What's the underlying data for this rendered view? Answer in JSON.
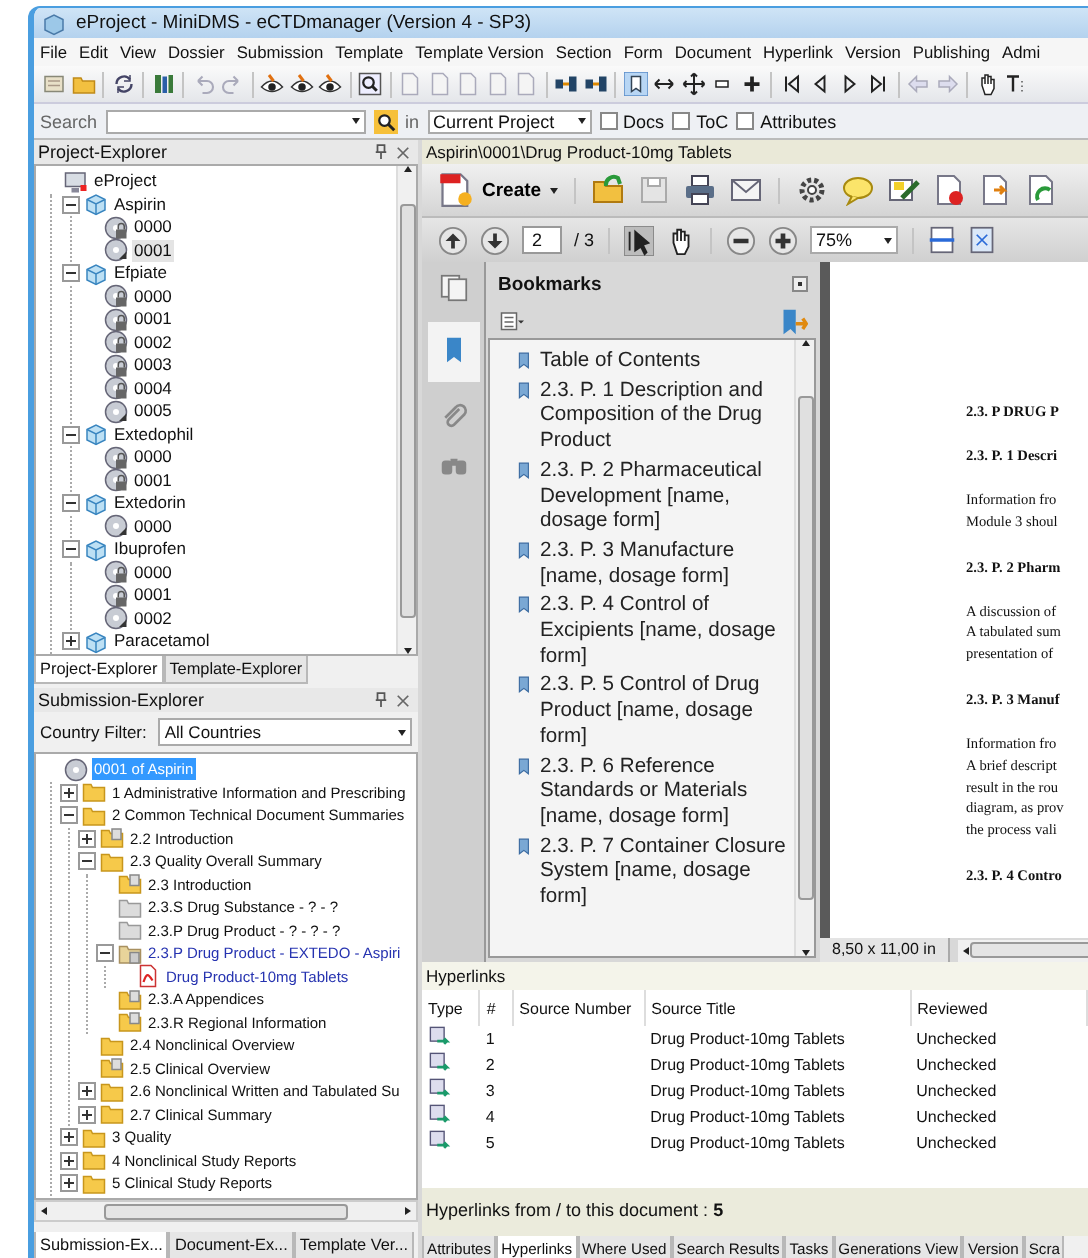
{
  "window": {
    "title": "eProject - MiniDMS - eCTDmanager (Version 4 - SP3)"
  },
  "menu": [
    "File",
    "Edit",
    "View",
    "Dossier",
    "Submission",
    "Template",
    "Template Version",
    "Section",
    "Form",
    "Document",
    "Hyperlink",
    "Version",
    "Publishing",
    "Admi"
  ],
  "search_bar": {
    "label": "Search",
    "scope_label": "in",
    "scope": "Current Project",
    "options": [
      {
        "label": "Docs",
        "checked": false
      },
      {
        "label": "ToC",
        "checked": false
      },
      {
        "label": "Attributes",
        "checked": false
      }
    ]
  },
  "project_explorer": {
    "title": "Project-Explorer",
    "tree": [
      {
        "label": "eProject",
        "kind": "project",
        "selected": false,
        "children": [
          {
            "label": "Aspirin",
            "kind": "product",
            "expanded": true,
            "selected": false,
            "children": [
              {
                "label": "0000",
                "kind": "sequence",
                "locked": true,
                "selected": false
              },
              {
                "label": "0001",
                "kind": "sequence",
                "locked": false,
                "selected": true
              }
            ]
          },
          {
            "label": "Efpiate",
            "kind": "product",
            "expanded": true,
            "selected": false,
            "children": [
              {
                "label": "0000",
                "kind": "sequence",
                "locked": true,
                "selected": false
              },
              {
                "label": "0001",
                "kind": "sequence",
                "locked": true,
                "selected": false
              },
              {
                "label": "0002",
                "kind": "sequence",
                "locked": true,
                "selected": false
              },
              {
                "label": "0003",
                "kind": "sequence",
                "locked": true,
                "selected": false
              },
              {
                "label": "0004",
                "kind": "sequence",
                "locked": true,
                "selected": false
              },
              {
                "label": "0005",
                "kind": "sequence",
                "locked": false,
                "selected": false
              }
            ]
          },
          {
            "label": "Extedophil",
            "kind": "product",
            "expanded": true,
            "selected": false,
            "children": [
              {
                "label": "0000",
                "kind": "sequence",
                "locked": true,
                "selected": false
              },
              {
                "label": "0001",
                "kind": "sequence",
                "locked": true,
                "selected": false
              }
            ]
          },
          {
            "label": "Extedorin",
            "kind": "product",
            "expanded": true,
            "selected": false,
            "children": [
              {
                "label": "0000",
                "kind": "sequence",
                "locked": false,
                "selected": false
              }
            ]
          },
          {
            "label": "Ibuprofen",
            "kind": "product",
            "expanded": true,
            "selected": false,
            "children": [
              {
                "label": "0000",
                "kind": "sequence",
                "locked": true,
                "selected": false
              },
              {
                "label": "0001",
                "kind": "sequence",
                "locked": true,
                "selected": false
              },
              {
                "label": "0002",
                "kind": "sequence",
                "locked": false,
                "selected": false
              }
            ]
          },
          {
            "label": "Paracetamol",
            "kind": "product",
            "expanded": false,
            "selected": false
          }
        ]
      }
    ]
  },
  "explorer_tabs": [
    {
      "label": "Project-Explorer",
      "selected": true
    },
    {
      "label": "Template-Explorer",
      "selected": false
    }
  ],
  "submission_explorer": {
    "title": "Submission-Explorer",
    "filter_label": "Country Filter:",
    "filter_value": "All Countries",
    "tree": [
      {
        "label": "0001 of Aspirin",
        "kind": "submission",
        "selected": true,
        "children": [
          {
            "label": "1 Administrative Information and Prescribing",
            "kind": "folder",
            "expanded": false,
            "selected": false
          },
          {
            "label": "2 Common Technical Document Summaries",
            "kind": "folder",
            "expanded": true,
            "selected": false,
            "children": [
              {
                "label": "2.2 Introduction",
                "kind": "folder-with-page",
                "expanded": false,
                "selected": false
              },
              {
                "label": "2.3 Quality Overall Summary",
                "kind": "folder",
                "expanded": true,
                "selected": false,
                "children": [
                  {
                    "label": "2.3 Introduction",
                    "kind": "folder-with-page",
                    "selected": false
                  },
                  {
                    "label": "2.3.S Drug Substance - ? - ?",
                    "kind": "empty-folder",
                    "selected": false
                  },
                  {
                    "label": "2.3.P Drug Product - ? - ? - ?",
                    "kind": "empty-folder",
                    "selected": false
                  },
                  {
                    "label": "2.3.P Drug Product - EXTEDO - Aspiri",
                    "kind": "linked-folder",
                    "expanded": true,
                    "selected": false,
                    "children": [
                      {
                        "label": "Drug Product-10mg Tablets",
                        "kind": "document",
                        "selected": false
                      }
                    ]
                  },
                  {
                    "label": "2.3.A Appendices",
                    "kind": "folder-with-page",
                    "selected": false
                  },
                  {
                    "label": "2.3.R Regional Information",
                    "kind": "folder-with-page",
                    "selected": false
                  }
                ]
              },
              {
                "label": "2.4 Nonclinical Overview",
                "kind": "folder",
                "selected": false
              },
              {
                "label": "2.5 Clinical Overview",
                "kind": "folder-with-page",
                "selected": false
              },
              {
                "label": "2.6 Nonclinical Written and Tabulated Su",
                "kind": "folder",
                "expanded": false,
                "selected": false
              },
              {
                "label": "2.7 Clinical Summary",
                "kind": "folder",
                "expanded": false,
                "selected": false
              }
            ]
          },
          {
            "label": "3 Quality",
            "kind": "folder",
            "expanded": false,
            "selected": false
          },
          {
            "label": "4 Nonclinical Study Reports",
            "kind": "folder",
            "expanded": false,
            "selected": false
          },
          {
            "label": "5 Clinical Study Reports",
            "kind": "folder",
            "expanded": false,
            "selected": false
          }
        ]
      }
    ]
  },
  "left_tabs": [
    {
      "label": "Submission-Ex...",
      "selected": true
    },
    {
      "label": "Document-Ex...",
      "selected": false
    },
    {
      "label": "Template Ver...",
      "selected": false
    }
  ],
  "document": {
    "path": "Aspirin\\0001\\Drug Product-10mg Tablets",
    "create": "Create",
    "page": "2",
    "page_count": "/ 3",
    "zoom": "75%",
    "page_size": "8,50 x 11,00 in"
  },
  "bookmarks": {
    "title": "Bookmarks",
    "items": [
      "Table of Contents",
      "2.3. P. 1 Description and Composition of the Drug Product",
      "2.3. P. 2 Pharmaceutical Development [name, dosage form]",
      "2.3. P. 3 Manufacture [name, dosage form]",
      "2.3. P. 4 Control of Excipients [name, dosage form]",
      "2.3. P. 5 Control of Drug Product [name, dosage form]",
      "2.3. P. 6 Reference Standards or Materials [name, dosage form]",
      "2.3. P. 7 Container Closure System [name, dosage form]"
    ]
  },
  "page_content": [
    {
      "kind": "heading",
      "text": "2.3. P DRUG P"
    },
    {
      "kind": "heading",
      "text": "2.3. P. 1 Descri"
    },
    {
      "kind": "paragraph",
      "lines": [
        "Information fro",
        "Module 3 shoul"
      ]
    },
    {
      "kind": "heading",
      "text": "2.3. P. 2 Pharm"
    },
    {
      "kind": "paragraph",
      "lines": [
        "A discussion of",
        "A tabulated sum",
        "presentation of"
      ]
    },
    {
      "kind": "heading",
      "text": "2.3. P. 3 Manuf"
    },
    {
      "kind": "paragraph",
      "lines": [
        "Information fro",
        "A brief descript",
        "result in the rou",
        "diagram, as prov",
        "the process vali"
      ]
    },
    {
      "kind": "heading",
      "text": "2.3. P. 4 Contro"
    }
  ],
  "hyperlinks": {
    "title": "Hyperlinks",
    "columns": [
      "Type",
      "#",
      "Source Number",
      "Source Title",
      "Reviewed"
    ],
    "rows": [
      {
        "number": "1",
        "source_title": "Drug Product-10mg Tablets",
        "reviewed": "Unchecked"
      },
      {
        "number": "2",
        "source_title": "Drug Product-10mg Tablets",
        "reviewed": "Unchecked"
      },
      {
        "number": "3",
        "source_title": "Drug Product-10mg Tablets",
        "reviewed": "Unchecked"
      },
      {
        "number": "4",
        "source_title": "Drug Product-10mg Tablets",
        "reviewed": "Unchecked"
      },
      {
        "number": "5",
        "source_title": "Drug Product-10mg Tablets",
        "reviewed": "Unchecked"
      }
    ],
    "summary": "Hyperlinks from / to this document : **5**"
  },
  "bottom_tabs": [
    {
      "label": "Attributes",
      "selected": false
    },
    {
      "label": "Hyperlinks",
      "selected": true
    },
    {
      "label": "Where Used",
      "selected": false
    },
    {
      "label": "Search Results",
      "selected": false
    },
    {
      "label": "Tasks",
      "selected": false
    },
    {
      "label": "Generations View",
      "selected": false
    },
    {
      "label": "Version",
      "selected": false
    },
    {
      "label": "Scra",
      "selected": false
    }
  ]
}
